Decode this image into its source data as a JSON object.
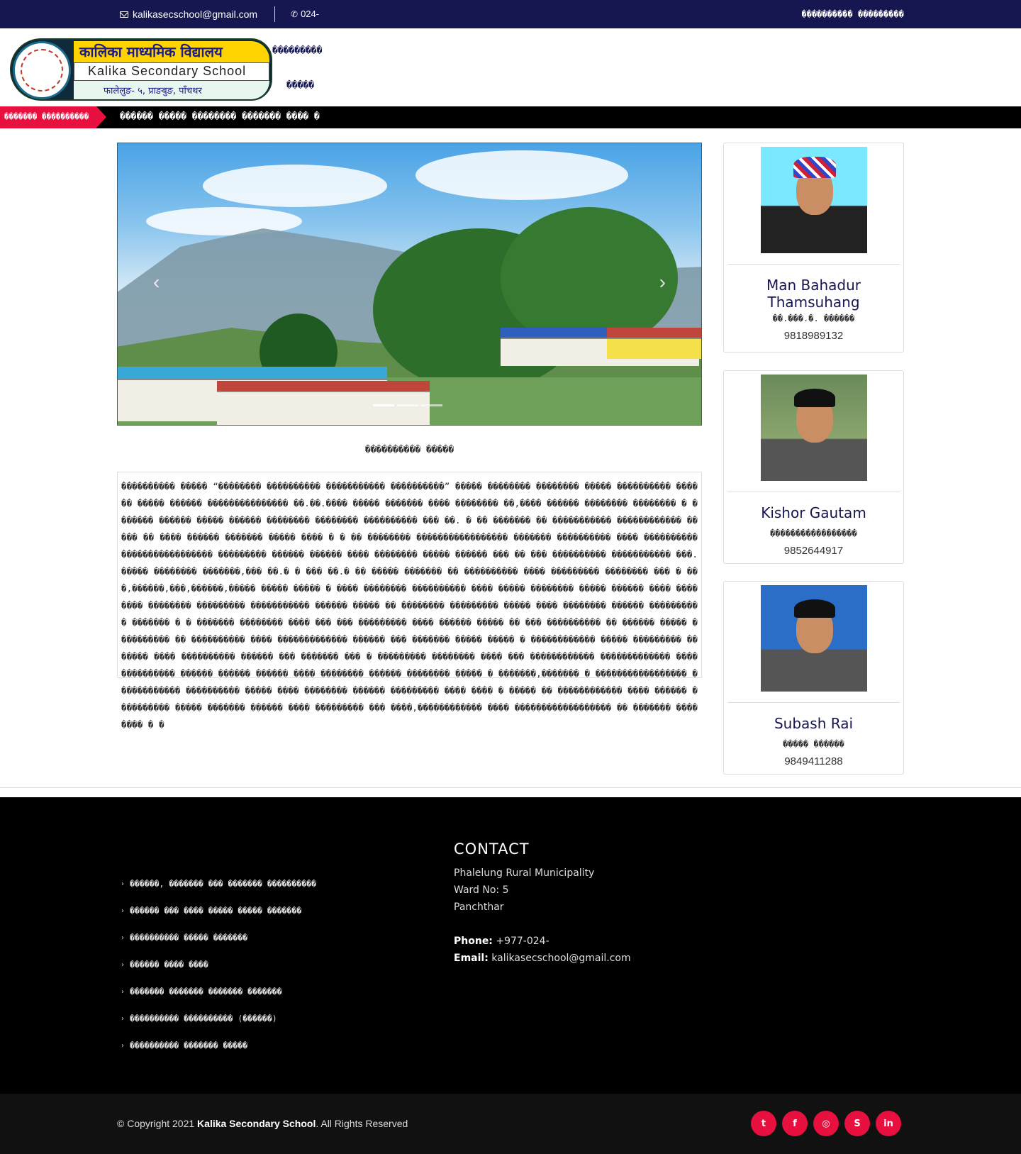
{
  "topbar": {
    "email": "kalikasecschool@gmail.com",
    "phone": "024-",
    "right_link": "���������� ���������"
  },
  "logo": {
    "line1": "कालिका माध्यमिक विद्यालय",
    "line2": "Kalika Secondary School",
    "line3": "फालेलुङ- ५, प्राङबुङ, पाँचथर"
  },
  "nav": {
    "items": [
      "���������",
      "�����",
      "�����"
    ]
  },
  "ticker": {
    "label": "������� ����������",
    "text": "������ ����� �������� ������� ���� �"
  },
  "slider": {
    "prev_label": "‹",
    "next_label": "›"
  },
  "about": {
    "title": "���������� �����",
    "body": "���������� ����� “�������� ���������� ����������� ����������” ����� �������� �������� ����� ���������� ������ ����� ������ ��������������� ��.��.���� ����� ������� ���� �������� ��,���� ������ �������� �������� � ������� ������ ����� ������ �������� �������� ���������� ��� ��. � �� ������� �� ����������� ������������ ����� �� ���� ������ ������� ����� ���� � � �� �������� ����������������� ������� ���������� ���� ���������� ����������������� ��������� ������ ������ ���� �������� ����� ������ ��� �� ��� ���������� ����������� ���. ����� �������� �������,��� ��.� � ��� ��.� �� ����� ������� �� ���������� ���� ��������� �������� ��� � ���,������,���,������,����� ����� ����� � ���� �������� ���������� ���� ����� �������� ����� ������ ���� �������� �������� ��������� ����������� ������ ����� �� �������� ��������� ����� ���� �������� ������ ���������� ������� � � ������� �������� ���� ��� ��� ��������� ���� ������ ����� �� ��� ���������� �� ������ ����� ���������� �� ���������� ���� ������������� ������ ��� ������� ����� ����� � ������������ ����� ��������� ������� ���� ���������� ������ ��� ������� ��� � ��������� �������� ���� ��� ������������ ������������� ���� ���������� ������ ������ ������ ���� �������� ������ �������� ����� � �������,������� � ����������������� ������������ ���������� ����� ���� �������� ������ ��������� ���� ���� � ����� �� ������������ ���� ������ ���������� ����� ������� ������ ���� ��������� ��� ����,������������ ���� ������������������ �� ������� �������� � �"
  },
  "staff": [
    {
      "name": "Man Bahadur Thamsuhang",
      "role": "��.���.�. ������",
      "phone": "9818989132"
    },
    {
      "name": "Kishor Gautam",
      "role": "�����������������",
      "phone": "9852644917"
    },
    {
      "name": "Subash Rai",
      "role": "����� ������",
      "phone": "9849411288"
    }
  ],
  "footer": {
    "links": [
      "������, ������� ��� ������� ����������",
      "������ ��� ���� ����� ����� �������",
      "���������� ����� �������",
      "������ ���� ����",
      "������� ������� ������� �������",
      "���������� ���������� (������)",
      "���������� ������� �����"
    ],
    "contact": {
      "heading": "CONTACT",
      "address1": "Phalelung Rural Municipality",
      "address2": "Ward No: 5",
      "address3": "Panchthar",
      "phone_label": "Phone:",
      "phone_value": "+977-024-",
      "email_label": "Email:",
      "email_value": "kalikasecschool@gmail.com"
    }
  },
  "bottom": {
    "copyright_prefix": "© Copyright 2021 ",
    "school": "Kalika Secondary School",
    "suffix": ". All Rights Reserved",
    "socials": [
      {
        "icon": "twitter-icon",
        "glyph": "t"
      },
      {
        "icon": "facebook-icon",
        "glyph": "f"
      },
      {
        "icon": "instagram-icon",
        "glyph": "◎"
      },
      {
        "icon": "skype-icon",
        "glyph": "S"
      },
      {
        "icon": "linkedin-icon",
        "glyph": "in"
      }
    ]
  },
  "colors": {
    "navy": "#161650",
    "accent": "#e8103f"
  }
}
